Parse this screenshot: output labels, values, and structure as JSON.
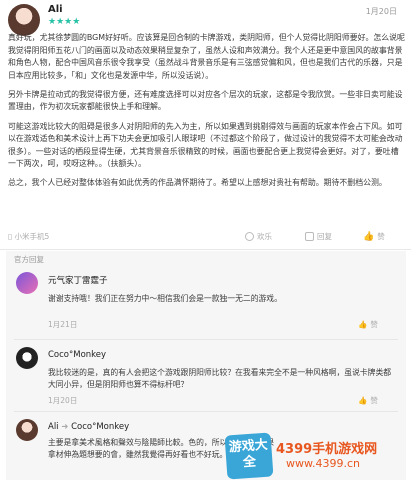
{
  "review": {
    "username": "Ali",
    "stars": "★★★★",
    "date": "1月20日",
    "paragraphs": [
      "真好玩，尤其徐梦圆的BGM好好听。应该算是回合制的卡牌游戏，类阴阳师，但个人觉得比阴阳师要好。怎么说呢我觉得阴阳师五花八门的画面以及动态效果稍显复杂了，虽然人设和声效满分。我个人还是更中意国风的故事背景和角色人物，配合中国风音乐很令我享受（虽然战斗背景音乐是有三弦感觉偏和风，但也是我们古代的乐器，只是日本应用比较多，「和」文化也是发源中华，所以没话说）。",
      "另外卡牌是拉动式的我觉得很方便，还有难度选择可以对应各个层次的玩家，这都是令我欣赏。一些非日卖可能设置理由，作为初次玩家都能很快上手和理解。",
      "可能这游戏比较大的阻碍是很多人对阴阳师的先入为主，所以如果遇到挑剔得效与画面的玩家本作会占下风。如可以在游戏适色和美术设计上再下功夫会更加吸引人眼球吧（不过都这个阶段了，做过设计的我觉得不太可能会改动很多）。一些对话的栖段显得生硬，尤其背景音乐很精致的时候，画面也要配合更上我觉得会更好。对了，要吐槽一下两次，呵，哎呀这种。。（扶额头）。",
      "总之，我个人已经对整体体验有如此优秀的作品满怀期待了。希望以上感想对贵社有帮助。期待不删档公测。"
    ],
    "device": "小米手机5",
    "actions": [
      "欢乐",
      "回复",
      "赞"
    ]
  },
  "official_section_label": "官方回复",
  "replies": [
    {
      "name": "元气家丁雷霆子",
      "text": "谢谢支持哦！我们正在努力中～相信我们会是一款独一无二的游戏。",
      "date": "1月21日",
      "action": "赞"
    },
    {
      "name": "Coco°Monkey",
      "text": "我比较迷的是，真的有人会把这个游戏跟阴阳师比较？在我看来完全不是一种风格啊，虽说卡牌类都大同小异，但是阴阳师也算不得标杆吧？",
      "date": "1月20日",
      "action": "赞"
    },
    {
      "name": "Ali",
      "reply_to": "Coco°Monkey",
      "text": "主要是拿美术風格和聲效与陰陽師比較。色的，所以遺數遊戲如果拿材伸為題想要的會，雖然我覺得再好看也不好玩。",
      "date": "",
      "action": ""
    }
  ],
  "watermark": {
    "badge": "游戏大全",
    "title": "4399手机游戏网",
    "url": "www.4399.cn"
  },
  "colors": {
    "accent": "#27c2a8",
    "reply_bg": "#f6f6f6",
    "watermark": "#e8571f"
  }
}
